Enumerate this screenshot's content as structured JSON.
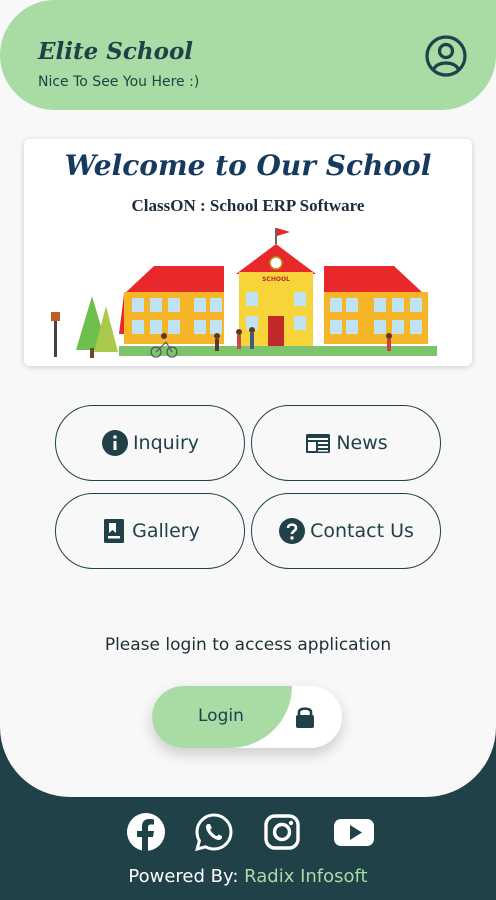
{
  "header": {
    "title": "Elite School",
    "subtitle": "Nice To See You Here :)"
  },
  "banner": {
    "title": "Welcome to Our School",
    "subtitle": "ClassON : School ERP Software",
    "sign_text": "SCHOOL"
  },
  "menu": [
    {
      "label": "Inquiry",
      "icon": "info-icon"
    },
    {
      "label": "News",
      "icon": "newspaper-icon"
    },
    {
      "label": "Gallery",
      "icon": "gallery-bookmark-icon"
    },
    {
      "label": "Contact Us",
      "icon": "help-circle-icon"
    }
  ],
  "login": {
    "prompt": "Please login to access application",
    "button_label": "Login"
  },
  "footer": {
    "socials": [
      "facebook-icon",
      "whatsapp-icon",
      "instagram-icon",
      "youtube-icon"
    ],
    "powered_prefix": "Powered By:",
    "powered_brand": "Radix Infosoft"
  },
  "colors": {
    "accent_green": "#a8dca4",
    "dark_teal": "#1f4147",
    "background": "#f8f8f8"
  }
}
